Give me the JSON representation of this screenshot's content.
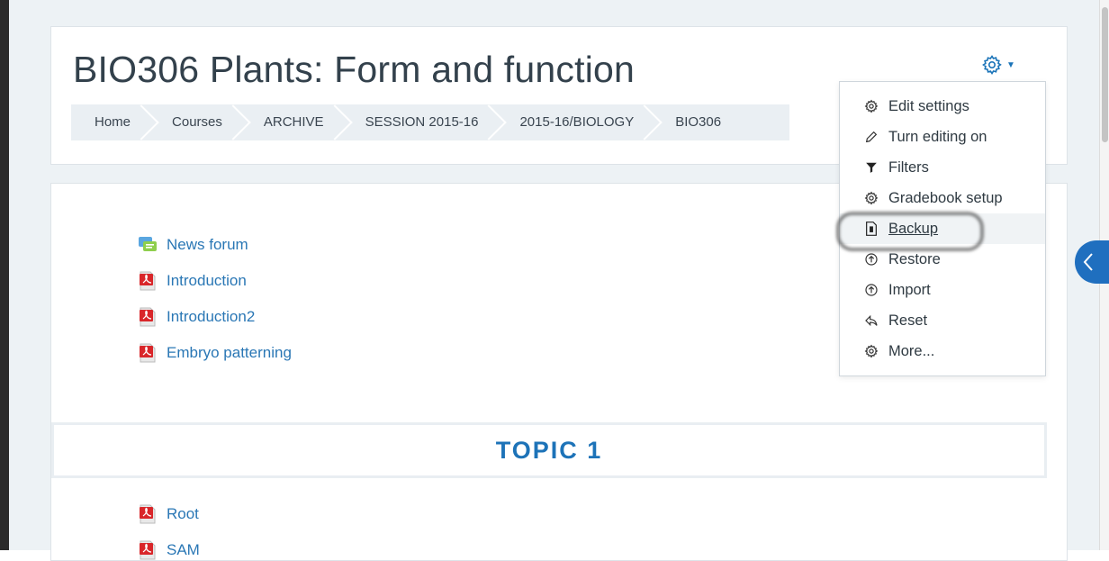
{
  "header": {
    "title": "BIO306 Plants: Form and function",
    "breadcrumb": [
      "Home",
      "Courses",
      "ARCHIVE",
      "SESSION 2015-16",
      "2015-16/BIOLOGY",
      "BIO306"
    ]
  },
  "actions_menu": {
    "toggle_icon": "gear-icon",
    "items": [
      {
        "label": "Edit settings",
        "icon": "gear-icon"
      },
      {
        "label": "Turn editing on",
        "icon": "pencil-icon"
      },
      {
        "label": "Filters",
        "icon": "filter-icon"
      },
      {
        "label": "Gradebook setup",
        "icon": "gear-icon"
      },
      {
        "label": "Backup",
        "icon": "file-icon"
      },
      {
        "label": "Restore",
        "icon": "upload-circle-icon"
      },
      {
        "label": "Import",
        "icon": "upload-circle-icon"
      },
      {
        "label": "Reset",
        "icon": "reply-icon"
      },
      {
        "label": "More...",
        "icon": "gear-icon"
      }
    ],
    "highlighted": "Backup"
  },
  "activities": [
    {
      "label": "News forum",
      "icon": "forum-icon"
    },
    {
      "label": "Introduction",
      "icon": "pdf-icon"
    },
    {
      "label": "Introduction2",
      "icon": "pdf-icon"
    },
    {
      "label": "Embryo patterning",
      "icon": "pdf-icon"
    }
  ],
  "topic": {
    "title": "TOPIC 1",
    "activities": [
      {
        "label": "Root",
        "icon": "pdf-icon"
      },
      {
        "label": "SAM",
        "icon": "pdf-icon"
      }
    ]
  },
  "colors": {
    "link": "#2a77b5",
    "accent": "#1d73b8",
    "side_tab": "#1f6fbf"
  }
}
